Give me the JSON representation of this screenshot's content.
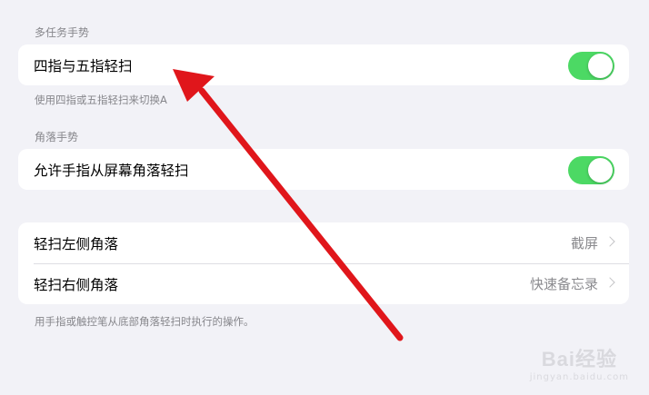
{
  "multitask": {
    "header": "多任务手势",
    "row_label": "四指与五指轻扫",
    "toggle_on": true,
    "footer": "使用四指或五指轻扫来切换A"
  },
  "corner": {
    "header": "角落手势",
    "row_label": "允许手指从屏幕角落轻扫",
    "toggle_on": true
  },
  "corner_actions": {
    "rows": [
      {
        "label": "轻扫左侧角落",
        "value": "截屏"
      },
      {
        "label": "轻扫右侧角落",
        "value": "快速备忘录"
      }
    ],
    "footer": "用手指或触控笔从底部角落轻扫时执行的操作。"
  },
  "colors": {
    "toggle_on": "#4cd964",
    "arrow": "#e0161b",
    "background": "#f2f2f7"
  },
  "watermark": {
    "brand": "Bai经验",
    "url": "jingyan.baidu.com"
  }
}
